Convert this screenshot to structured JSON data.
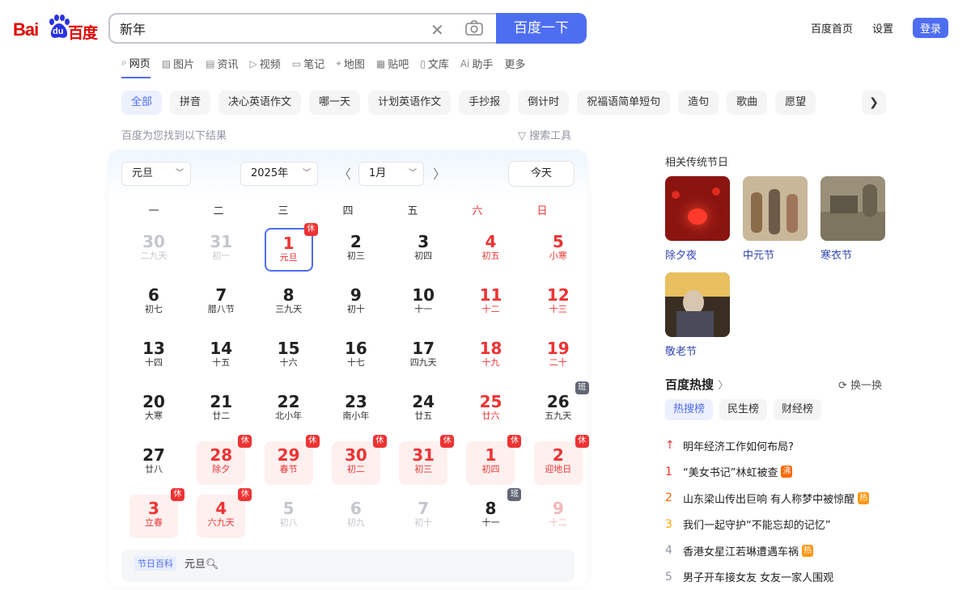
{
  "logo": {
    "text_latin": "Bai",
    "text_du": "du",
    "text_cn": "百度"
  },
  "search": {
    "query": "新年",
    "button": "百度一下"
  },
  "top_links": {
    "home": "百度首页",
    "settings": "设置",
    "login": "登录"
  },
  "tabs": [
    {
      "label": "网页",
      "icon": "search-icon",
      "active": true
    },
    {
      "label": "图片",
      "icon": "image-icon"
    },
    {
      "label": "资讯",
      "icon": "news-icon"
    },
    {
      "label": "视频",
      "icon": "video-icon"
    },
    {
      "label": "笔记",
      "icon": "note-icon"
    },
    {
      "label": "地图",
      "icon": "map-icon"
    },
    {
      "label": "贴吧",
      "icon": "tieba-icon"
    },
    {
      "label": "文库",
      "icon": "doc-icon"
    },
    {
      "label": "助手",
      "icon": "ai-icon"
    },
    {
      "label": "更多"
    }
  ],
  "chips": [
    "全部",
    "拼音",
    "决心英语作文",
    "哪一天",
    "计划英语作文",
    "手抄报",
    "倒计时",
    "祝福语简单短句",
    "造句",
    "歌曲",
    "愿望"
  ],
  "results_info": "百度为您找到以下结果",
  "search_tools": "搜索工具",
  "calendar": {
    "holiday_select": "元旦",
    "year_select": "2025年",
    "month_select": "1月",
    "today_button": "今天",
    "weekdays": [
      "一",
      "二",
      "三",
      "四",
      "五",
      "六",
      "日"
    ],
    "days": [
      {
        "n": "30",
        "l": "二九天",
        "other": true
      },
      {
        "n": "31",
        "l": "初一",
        "other": true
      },
      {
        "n": "1",
        "l": "元旦",
        "today": true,
        "tag": "休"
      },
      {
        "n": "2",
        "l": "初三"
      },
      {
        "n": "3",
        "l": "初四"
      },
      {
        "n": "4",
        "l": "初五",
        "wkend": true
      },
      {
        "n": "5",
        "l": "小寒",
        "wkend": true
      },
      {
        "n": "6",
        "l": "初七"
      },
      {
        "n": "7",
        "l": "腊八节"
      },
      {
        "n": "8",
        "l": "三九天"
      },
      {
        "n": "9",
        "l": "初十"
      },
      {
        "n": "10",
        "l": "十一"
      },
      {
        "n": "11",
        "l": "十二",
        "wkend": true
      },
      {
        "n": "12",
        "l": "十三",
        "wkend": true
      },
      {
        "n": "13",
        "l": "十四"
      },
      {
        "n": "14",
        "l": "十五"
      },
      {
        "n": "15",
        "l": "十六"
      },
      {
        "n": "16",
        "l": "十七"
      },
      {
        "n": "17",
        "l": "四九天"
      },
      {
        "n": "18",
        "l": "十九",
        "wkend": true
      },
      {
        "n": "19",
        "l": "二十",
        "wkend": true
      },
      {
        "n": "20",
        "l": "大寒"
      },
      {
        "n": "21",
        "l": "廿二"
      },
      {
        "n": "22",
        "l": "北小年"
      },
      {
        "n": "23",
        "l": "南小年"
      },
      {
        "n": "24",
        "l": "廿五"
      },
      {
        "n": "25",
        "l": "廿六",
        "wkend": true
      },
      {
        "n": "26",
        "l": "五九天",
        "tag": "班"
      },
      {
        "n": "27",
        "l": "廿八"
      },
      {
        "n": "28",
        "l": "除夕",
        "rest": true,
        "tag": "休"
      },
      {
        "n": "29",
        "l": "春节",
        "rest": true,
        "tag": "休"
      },
      {
        "n": "30",
        "l": "初二",
        "rest": true,
        "tag": "休"
      },
      {
        "n": "31",
        "l": "初三",
        "rest": true,
        "tag": "休"
      },
      {
        "n": "1",
        "l": "初四",
        "rest": true,
        "tag": "休"
      },
      {
        "n": "2",
        "l": "迎地日",
        "rest": true,
        "tag": "休"
      },
      {
        "n": "3",
        "l": "立春",
        "rest": true,
        "tag": "休"
      },
      {
        "n": "4",
        "l": "六九天",
        "rest": true,
        "tag": "休"
      },
      {
        "n": "5",
        "l": "初八",
        "other": true
      },
      {
        "n": "6",
        "l": "初九",
        "other": true
      },
      {
        "n": "7",
        "l": "初十",
        "other": true
      },
      {
        "n": "8",
        "l": "十一",
        "tag": "班"
      },
      {
        "n": "9",
        "l": "十二",
        "other": true,
        "wkend": true
      }
    ],
    "baike_tag": "节日百科",
    "baike_term": "元旦"
  },
  "related": {
    "title": "相关传统节日",
    "festivals": [
      {
        "name": "除夕夜",
        "color": "#8a1410"
      },
      {
        "name": "中元节",
        "color": "#c9b79a"
      },
      {
        "name": "寒衣节",
        "color": "#9a907a"
      },
      {
        "name": "敬老节",
        "color": "#3a2e22"
      }
    ]
  },
  "hot": {
    "title": "百度热搜",
    "refresh": "换一换",
    "tabs": [
      "热搜榜",
      "民生榜",
      "财经榜"
    ],
    "items": [
      {
        "rank": "↑",
        "text": "明年经济工作如何布局?",
        "rank_color": "#e33"
      },
      {
        "rank": "1",
        "text": "“美女书记”林虹被查",
        "badge": "沸",
        "badge_color": "#ff6600",
        "rank_color": "#e33"
      },
      {
        "rank": "2",
        "text": "山东梁山传出巨响 有人称梦中被惊醒",
        "badge": "热",
        "badge_color": "#ff9812",
        "rank_color": "#ff6600"
      },
      {
        "rank": "3",
        "text": "我们一起守护“不能忘却的记忆”",
        "rank_color": "#faa90e"
      },
      {
        "rank": "4",
        "text": "香港女星江若琳遭遇车祸",
        "badge": "热",
        "badge_color": "#ff9812",
        "rank_color": "#9195a3"
      },
      {
        "rank": "5",
        "text": "男子开车接女友 女友一家人围观",
        "rank_color": "#9195a3"
      }
    ]
  }
}
